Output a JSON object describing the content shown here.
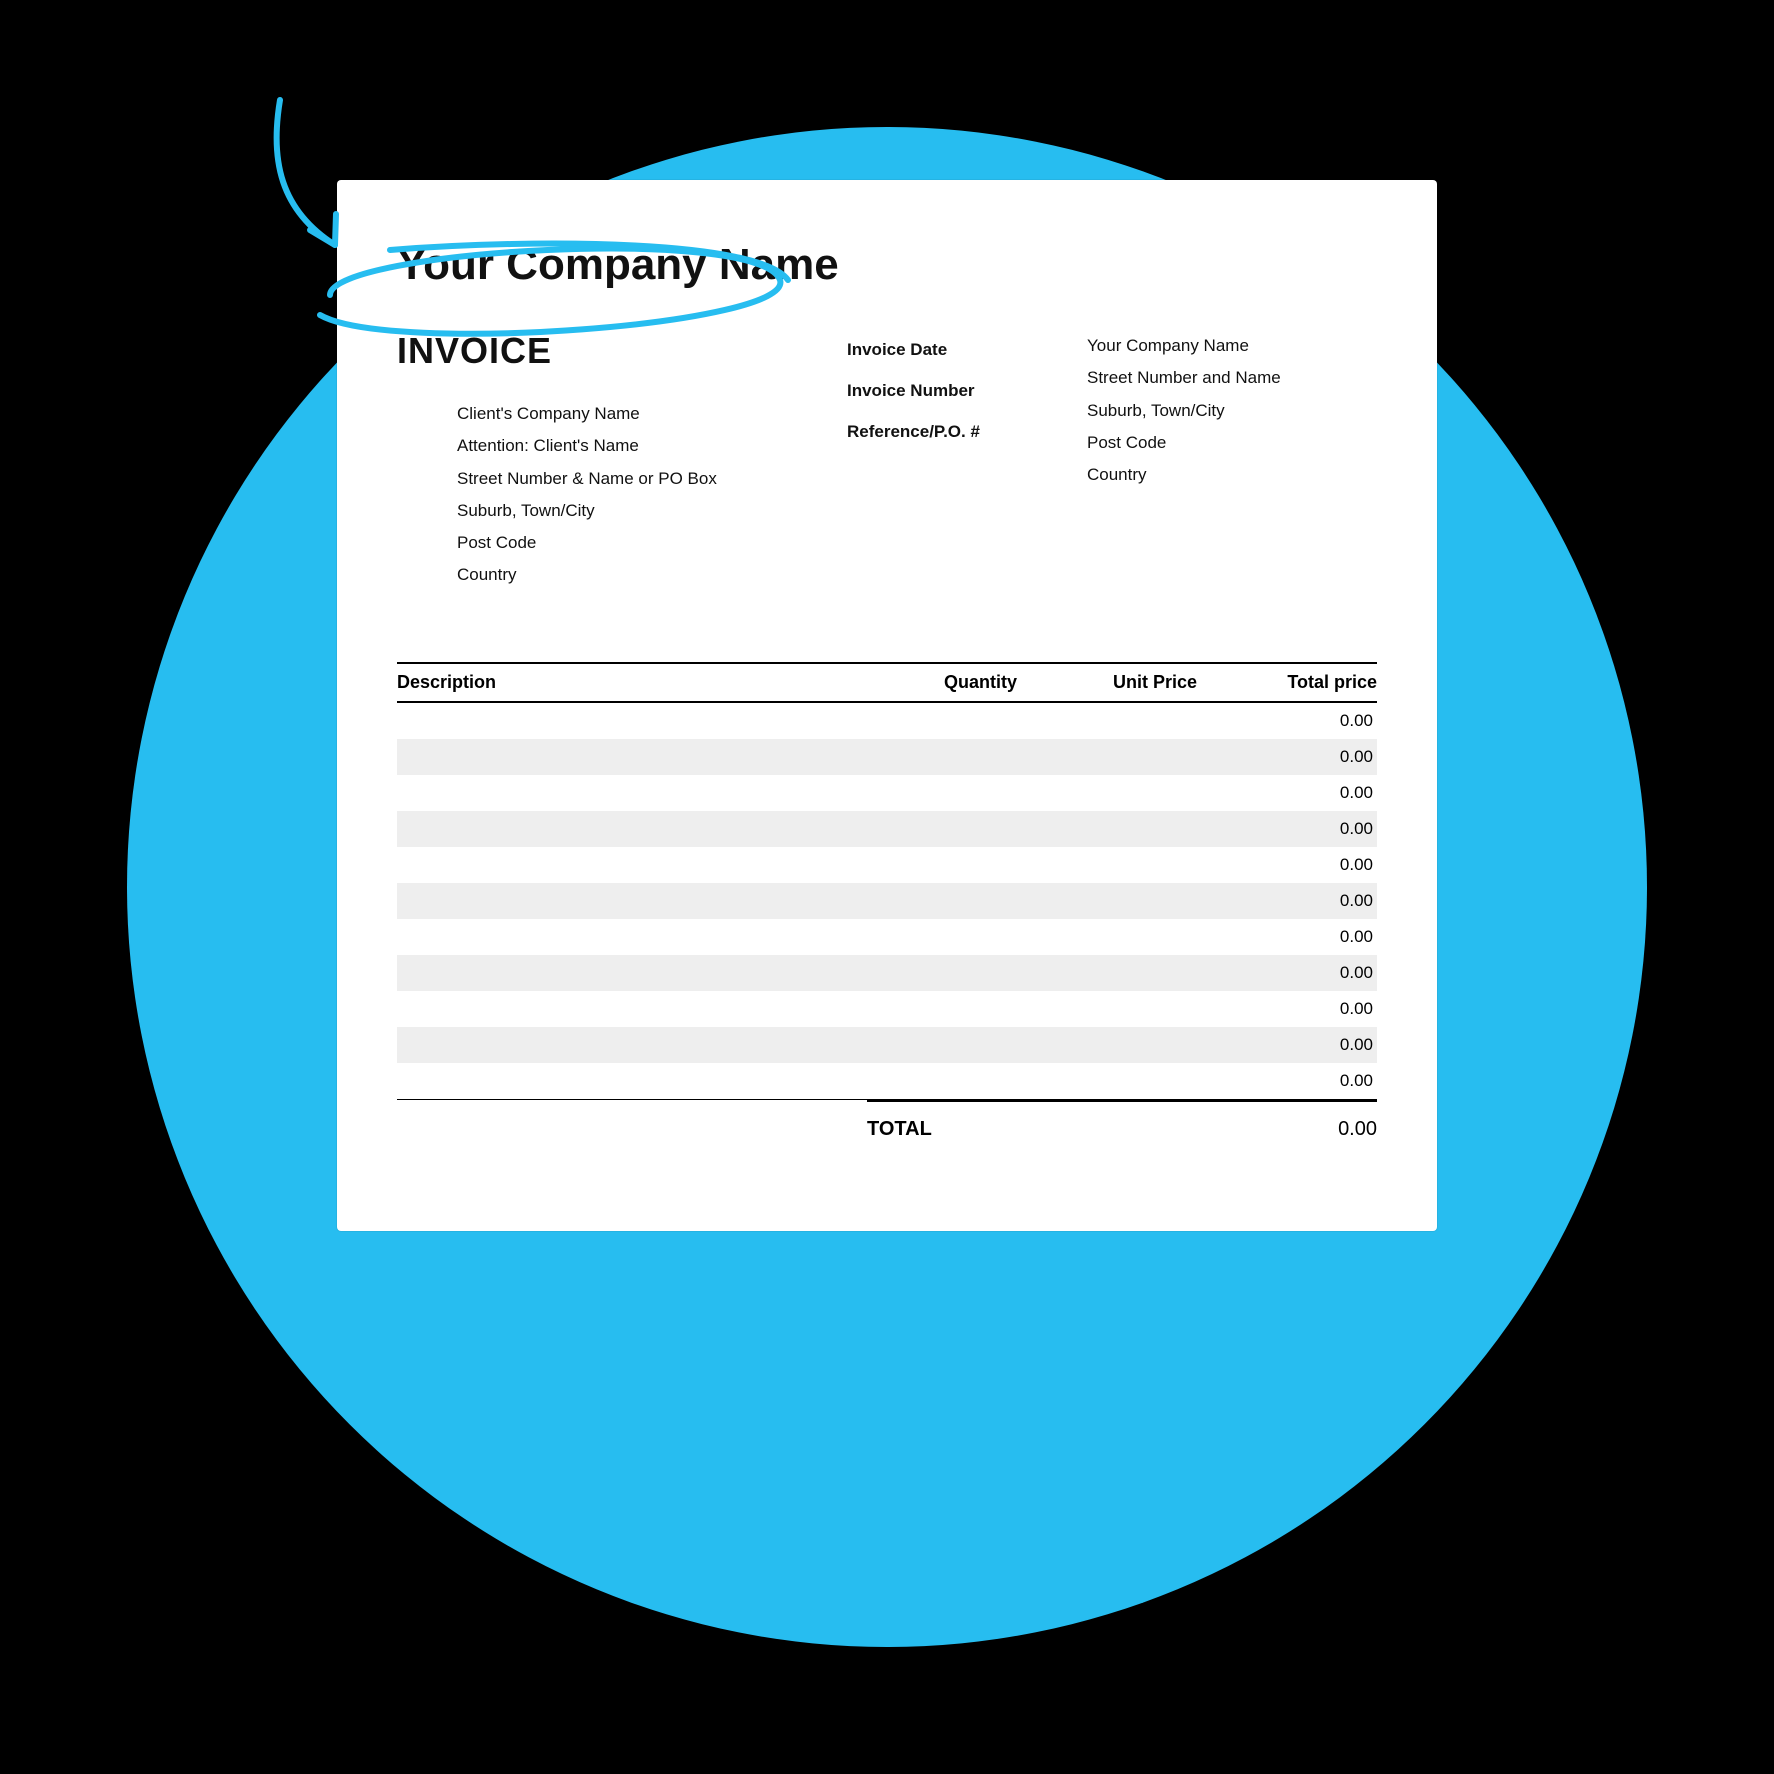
{
  "header": {
    "company_name": "Your Company Name",
    "title": "INVOICE"
  },
  "meta": {
    "date_label": "Invoice Date",
    "number_label": "Invoice Number",
    "ref_label": "Reference/P.O. #"
  },
  "from": {
    "name": "Your Company Name",
    "street": "Street Number and Name",
    "city": "Suburb, Town/City",
    "postcode": "Post Code",
    "country": "Country"
  },
  "bill_to": {
    "company": "Client's Company Name",
    "attn": "Attention: Client's Name",
    "street": "Street Number & Name or PO Box",
    "city": "Suburb, Town/City",
    "postcode": "Post Code",
    "country": "Country"
  },
  "columns": {
    "desc": "Description",
    "qty": "Quantity",
    "unit": "Unit Price",
    "total": "Total price"
  },
  "rows": [
    {
      "desc": "",
      "qty": "",
      "unit": "",
      "total": "0.00"
    },
    {
      "desc": "",
      "qty": "",
      "unit": "",
      "total": "0.00"
    },
    {
      "desc": "",
      "qty": "",
      "unit": "",
      "total": "0.00"
    },
    {
      "desc": "",
      "qty": "",
      "unit": "",
      "total": "0.00"
    },
    {
      "desc": "",
      "qty": "",
      "unit": "",
      "total": "0.00"
    },
    {
      "desc": "",
      "qty": "",
      "unit": "",
      "total": "0.00"
    },
    {
      "desc": "",
      "qty": "",
      "unit": "",
      "total": "0.00"
    },
    {
      "desc": "",
      "qty": "",
      "unit": "",
      "total": "0.00"
    },
    {
      "desc": "",
      "qty": "",
      "unit": "",
      "total": "0.00"
    },
    {
      "desc": "",
      "qty": "",
      "unit": "",
      "total": "0.00"
    },
    {
      "desc": "",
      "qty": "",
      "unit": "",
      "total": "0.00"
    }
  ],
  "totals": {
    "label": "TOTAL",
    "value": "0.00"
  }
}
